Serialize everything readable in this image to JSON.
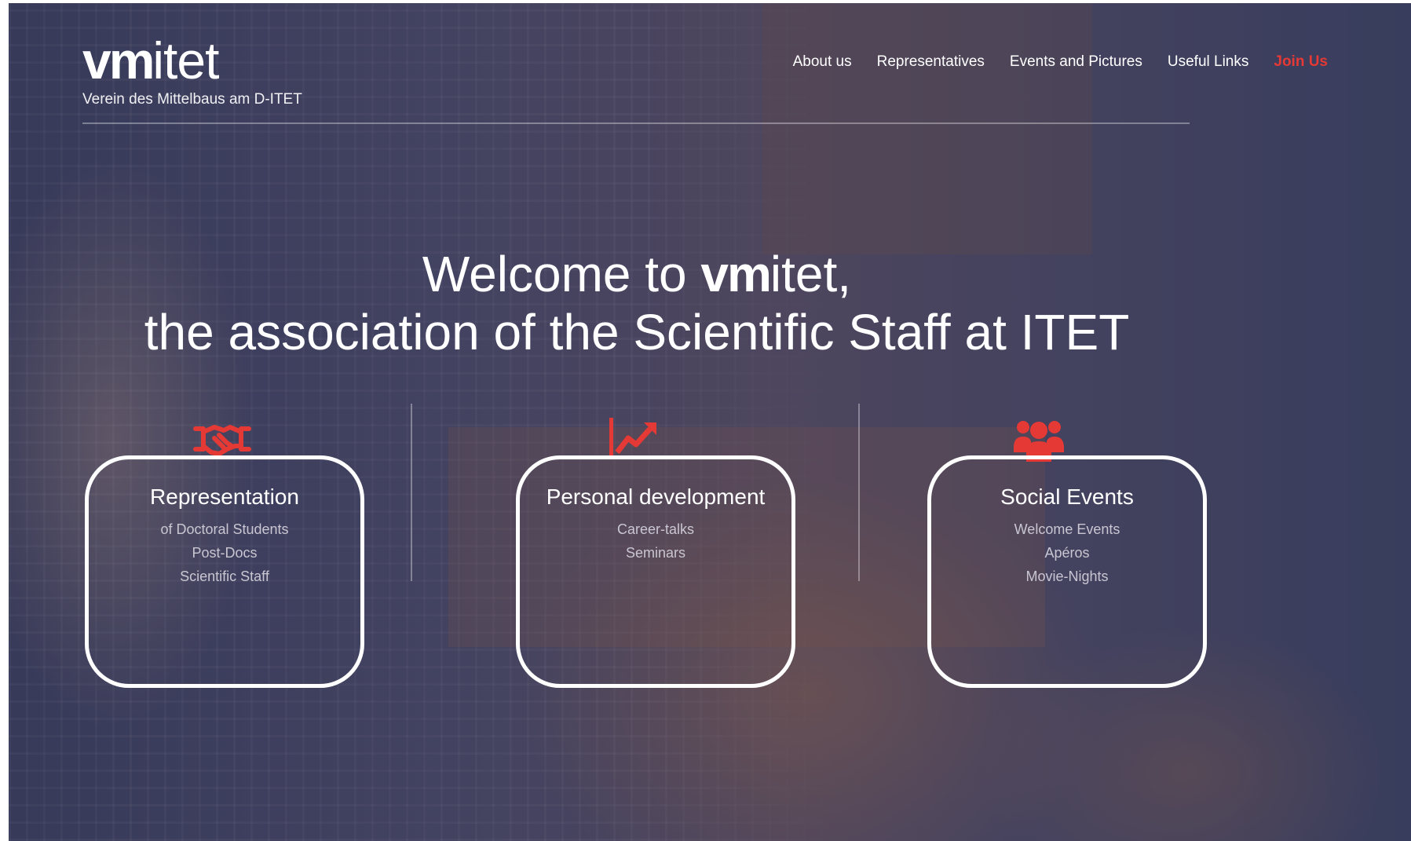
{
  "header": {
    "logo_bold": "vm",
    "logo_light": "itet",
    "tagline": "Verein des Mittelbaus am D-ITET"
  },
  "nav": {
    "items": [
      {
        "label": "About us"
      },
      {
        "label": "Representatives"
      },
      {
        "label": "Events and Pictures"
      },
      {
        "label": "Useful Links"
      },
      {
        "label": "Join Us"
      }
    ],
    "accent_color": "#e53935"
  },
  "hero": {
    "prefix": "Welcome to ",
    "brand_bold": "vm",
    "brand_light": "itet",
    "suffix": ",",
    "line2": "the association of the Scientific Staff at ITET"
  },
  "features": [
    {
      "icon": "handshake-icon",
      "title": "Representation",
      "items": [
        "of Doctoral Students",
        "Post-Docs",
        "Scientific Staff"
      ]
    },
    {
      "icon": "trending-up-icon",
      "title": "Personal development",
      "items": [
        "Career-talks",
        "Seminars"
      ]
    },
    {
      "icon": "group-icon",
      "title": "Social Events",
      "items": [
        "Welcome Events",
        "Apéros",
        "Movie-Nights"
      ]
    }
  ]
}
